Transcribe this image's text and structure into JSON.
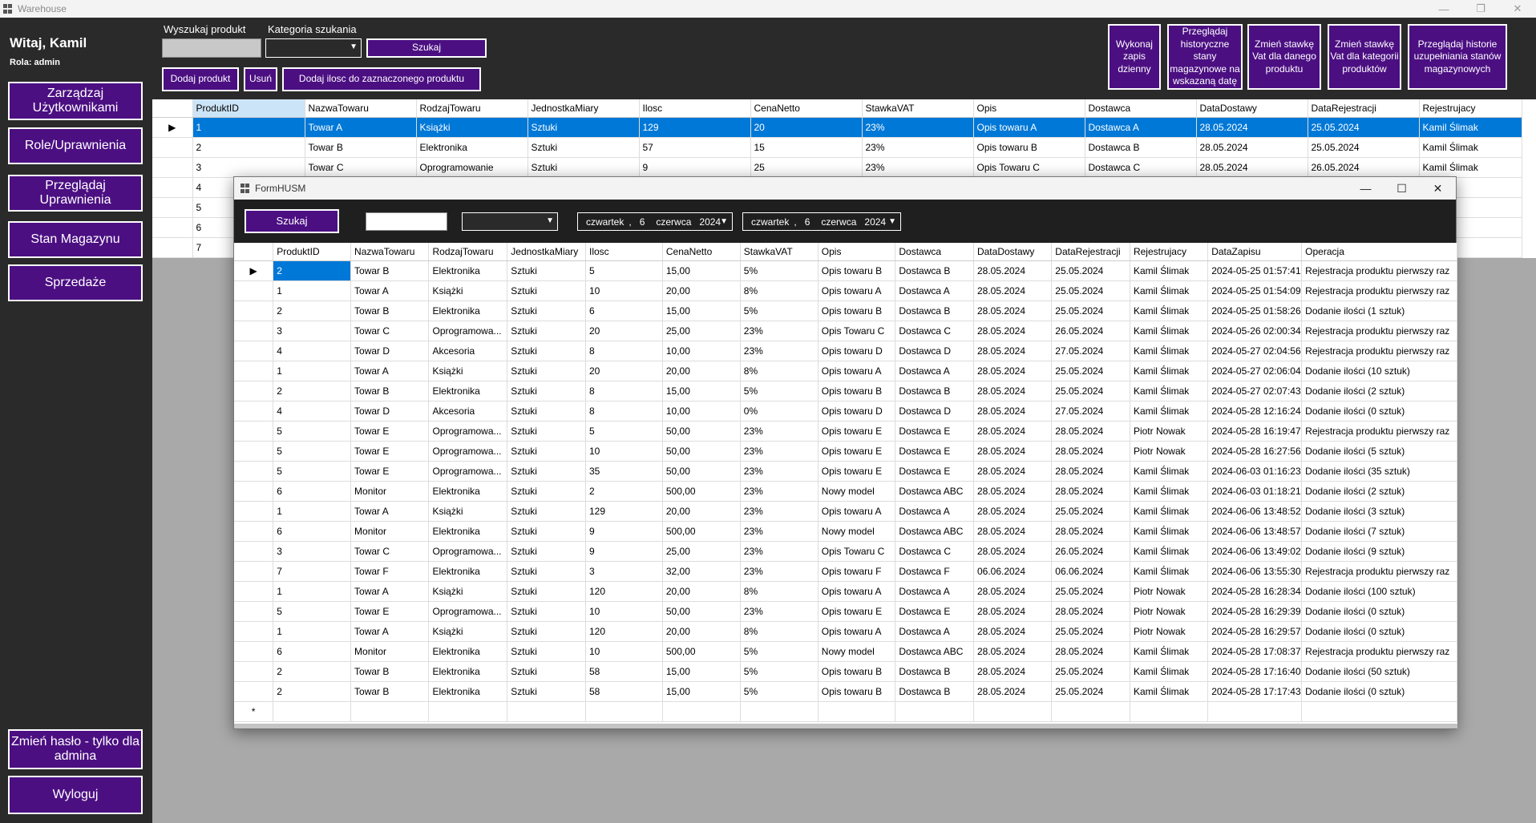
{
  "app": {
    "title": "Warehouse"
  },
  "window_controls": {
    "min": "—",
    "max": "❐",
    "close": "✕"
  },
  "sidebar": {
    "greeting": "Witaj, Kamil",
    "role": "Rola: admin",
    "buttons": {
      "manage_users": "Zarządzaj Użytkownikami",
      "roles": "Role/Uprawnienia",
      "view_permissions": "Przeglądaj Uprawnienia",
      "stock": "Stan Magazynu",
      "sales": "Sprzedaże",
      "change_password": "Zmień hasło - tylko dla admina",
      "logout": "Wyloguj"
    }
  },
  "toolbar": {
    "search_label": "Wyszukaj produkt",
    "category_label": "Kategoria szukania",
    "search_button": "Szukaj",
    "add_product": "Dodaj produkt",
    "delete": "Usuń",
    "add_quantity": "Dodaj ilosc do zaznaczonego produktu",
    "daily_save": "Wykonaj zapis dzienny",
    "history_states": "Przeglądaj historyczne stany magazynowe na wskazaną datę",
    "vat_product": "Zmień stawkę Vat dla danego produktu",
    "vat_category": "Zmień stawkę Vat dla kategorii produktów",
    "history_refill": "Przeglądaj historie uzupełniania stanów magazynowych"
  },
  "main_grid": {
    "columns": [
      "ProduktID",
      "NazwaTowaru",
      "RodzajTowaru",
      "JednostkaMiary",
      "Ilosc",
      "CenaNetto",
      "StawkaVAT",
      "Opis",
      "Dostawca",
      "DataDostawy",
      "DataRejestracji",
      "Rejestrujacy"
    ],
    "rows": [
      [
        "1",
        "Towar A",
        "Książki",
        "Sztuki",
        "129",
        "20",
        "23%",
        "Opis towaru A",
        "Dostawca A",
        "28.05.2024",
        "25.05.2024",
        "Kamil Ślimak"
      ],
      [
        "2",
        "Towar B",
        "Elektronika",
        "Sztuki",
        "57",
        "15",
        "23%",
        "Opis towaru B",
        "Dostawca B",
        "28.05.2024",
        "25.05.2024",
        "Kamil Ślimak"
      ],
      [
        "3",
        "Towar C",
        "Oprogramowanie",
        "Sztuki",
        "9",
        "25",
        "23%",
        "Opis Towaru C",
        "Dostawca C",
        "28.05.2024",
        "26.05.2024",
        "Kamil Ślimak"
      ],
      [
        "4",
        "",
        "",
        "",
        "",
        "",
        "",
        "",
        "",
        "",
        "",
        "Ślimak"
      ],
      [
        "5",
        "",
        "",
        "",
        "",
        "",
        "",
        "",
        "",
        "",
        "",
        "owak"
      ],
      [
        "6",
        "",
        "",
        "",
        "",
        "",
        "",
        "",
        "",
        "",
        "",
        "Ślimak"
      ],
      [
        "7",
        "",
        "",
        "",
        "",
        "",
        "",
        "",
        "",
        "",
        "",
        "Ślimak"
      ]
    ]
  },
  "modal": {
    "title": "FormHUSM",
    "search_button": "Szukaj",
    "date_from": {
      "day_name": "czwartek",
      "sep": ",",
      "day": "6",
      "month": "czerwca",
      "year": "2024"
    },
    "date_to": {
      "day_name": "czwartek",
      "sep": ",",
      "day": "6",
      "month": "czerwca",
      "year": "2024"
    },
    "columns": [
      "ProduktID",
      "NazwaTowaru",
      "RodzajTowaru",
      "JednostkaMiary",
      "Ilosc",
      "CenaNetto",
      "StawkaVAT",
      "Opis",
      "Dostawca",
      "DataDostawy",
      "DataRejestracji",
      "Rejestrujacy",
      "DataZapisu",
      "Operacja"
    ],
    "rows": [
      [
        "2",
        "Towar B",
        "Elektronika",
        "Sztuki",
        "5",
        "15,00",
        "5%",
        "Opis towaru B",
        "Dostawca B",
        "28.05.2024",
        "25.05.2024",
        "Kamil Ślimak",
        "2024-05-25 01:57:41",
        "Rejestracja produktu pierwszy raz"
      ],
      [
        "1",
        "Towar A",
        "Książki",
        "Sztuki",
        "10",
        "20,00",
        "8%",
        "Opis towaru A",
        "Dostawca A",
        "28.05.2024",
        "25.05.2024",
        "Kamil Ślimak",
        "2024-05-25 01:54:09",
        "Rejestracja produktu pierwszy raz"
      ],
      [
        "2",
        "Towar B",
        "Elektronika",
        "Sztuki",
        "6",
        "15,00",
        "5%",
        "Opis towaru B",
        "Dostawca B",
        "28.05.2024",
        "25.05.2024",
        "Kamil Ślimak",
        "2024-05-25 01:58:26",
        "Dodanie ilości (1 sztuk)"
      ],
      [
        "3",
        "Towar C",
        "Oprogramowa...",
        "Sztuki",
        "20",
        "25,00",
        "23%",
        "Opis Towaru C",
        "Dostawca C",
        "28.05.2024",
        "26.05.2024",
        "Kamil Ślimak",
        "2024-05-26 02:00:34",
        "Rejestracja produktu pierwszy raz"
      ],
      [
        "4",
        "Towar D",
        "Akcesoria",
        "Sztuki",
        "8",
        "10,00",
        "23%",
        "Opis towaru D",
        "Dostawca D",
        "28.05.2024",
        "27.05.2024",
        "Kamil Ślimak",
        "2024-05-27 02:04:56",
        "Rejestracja produktu pierwszy raz"
      ],
      [
        "1",
        "Towar A",
        "Książki",
        "Sztuki",
        "20",
        "20,00",
        "8%",
        "Opis towaru A",
        "Dostawca A",
        "28.05.2024",
        "25.05.2024",
        "Kamil Ślimak",
        "2024-05-27 02:06:04",
        "Dodanie ilości (10 sztuk)"
      ],
      [
        "2",
        "Towar B",
        "Elektronika",
        "Sztuki",
        "8",
        "15,00",
        "5%",
        "Opis towaru B",
        "Dostawca B",
        "28.05.2024",
        "25.05.2024",
        "Kamil Ślimak",
        "2024-05-27 02:07:43",
        "Dodanie ilości (2 sztuk)"
      ],
      [
        "4",
        "Towar D",
        "Akcesoria",
        "Sztuki",
        "8",
        "10,00",
        "0%",
        "Opis towaru D",
        "Dostawca D",
        "28.05.2024",
        "27.05.2024",
        "Kamil Ślimak",
        "2024-05-28 12:16:24",
        "Dodanie ilości (0 sztuk)"
      ],
      [
        "5",
        "Towar E",
        "Oprogramowa...",
        "Sztuki",
        "5",
        "50,00",
        "23%",
        "Opis towaru E",
        "Dostawca E",
        "28.05.2024",
        "28.05.2024",
        "Piotr Nowak",
        "2024-05-28 16:19:47",
        "Rejestracja produktu pierwszy raz"
      ],
      [
        "5",
        "Towar E",
        "Oprogramowa...",
        "Sztuki",
        "10",
        "50,00",
        "23%",
        "Opis towaru E",
        "Dostawca E",
        "28.05.2024",
        "28.05.2024",
        "Piotr Nowak",
        "2024-05-28 16:27:56",
        "Dodanie ilości (5 sztuk)"
      ],
      [
        "5",
        "Towar E",
        "Oprogramowa...",
        "Sztuki",
        "35",
        "50,00",
        "23%",
        "Opis towaru E",
        "Dostawca E",
        "28.05.2024",
        "28.05.2024",
        "Kamil Ślimak",
        "2024-06-03 01:16:23",
        "Dodanie ilości (35 sztuk)"
      ],
      [
        "6",
        "Monitor",
        "Elektronika",
        "Sztuki",
        "2",
        "500,00",
        "23%",
        "Nowy model",
        "Dostawca ABC",
        "28.05.2024",
        "28.05.2024",
        "Kamil Ślimak",
        "2024-06-03 01:18:21",
        "Dodanie ilości (2 sztuk)"
      ],
      [
        "1",
        "Towar A",
        "Książki",
        "Sztuki",
        "129",
        "20,00",
        "23%",
        "Opis towaru A",
        "Dostawca A",
        "28.05.2024",
        "25.05.2024",
        "Kamil Ślimak",
        "2024-06-06 13:48:52",
        "Dodanie ilości (3 sztuk)"
      ],
      [
        "6",
        "Monitor",
        "Elektronika",
        "Sztuki",
        "9",
        "500,00",
        "23%",
        "Nowy model",
        "Dostawca ABC",
        "28.05.2024",
        "28.05.2024",
        "Kamil Ślimak",
        "2024-06-06 13:48:57",
        "Dodanie ilości (7 sztuk)"
      ],
      [
        "3",
        "Towar C",
        "Oprogramowa...",
        "Sztuki",
        "9",
        "25,00",
        "23%",
        "Opis Towaru C",
        "Dostawca C",
        "28.05.2024",
        "26.05.2024",
        "Kamil Ślimak",
        "2024-06-06 13:49:02",
        "Dodanie ilości (9 sztuk)"
      ],
      [
        "7",
        "Towar F",
        "Elektronika",
        "Sztuki",
        "3",
        "32,00",
        "23%",
        "Opis towaru F",
        "Dostawca F",
        "06.06.2024",
        "06.06.2024",
        "Kamil Ślimak",
        "2024-06-06 13:55:30",
        "Rejestracja produktu pierwszy raz"
      ],
      [
        "1",
        "Towar A",
        "Książki",
        "Sztuki",
        "120",
        "20,00",
        "8%",
        "Opis towaru A",
        "Dostawca A",
        "28.05.2024",
        "25.05.2024",
        "Piotr Nowak",
        "2024-05-28 16:28:34",
        "Dodanie ilości (100 sztuk)"
      ],
      [
        "5",
        "Towar E",
        "Oprogramowa...",
        "Sztuki",
        "10",
        "50,00",
        "23%",
        "Opis towaru E",
        "Dostawca E",
        "28.05.2024",
        "28.05.2024",
        "Piotr Nowak",
        "2024-05-28 16:29:39",
        "Dodanie ilości (0 sztuk)"
      ],
      [
        "1",
        "Towar A",
        "Książki",
        "Sztuki",
        "120",
        "20,00",
        "8%",
        "Opis towaru A",
        "Dostawca A",
        "28.05.2024",
        "25.05.2024",
        "Piotr Nowak",
        "2024-05-28 16:29:57",
        "Dodanie ilości (0 sztuk)"
      ],
      [
        "6",
        "Monitor",
        "Elektronika",
        "Sztuki",
        "10",
        "500,00",
        "5%",
        "Nowy model",
        "Dostawca ABC",
        "28.05.2024",
        "28.05.2024",
        "Kamil Ślimak",
        "2024-05-28 17:08:37",
        "Rejestracja produktu pierwszy raz"
      ],
      [
        "2",
        "Towar B",
        "Elektronika",
        "Sztuki",
        "58",
        "15,00",
        "5%",
        "Opis towaru B",
        "Dostawca B",
        "28.05.2024",
        "25.05.2024",
        "Kamil Ślimak",
        "2024-05-28 17:16:40",
        "Dodanie ilości (50 sztuk)"
      ],
      [
        "2",
        "Towar B",
        "Elektronika",
        "Sztuki",
        "58",
        "15,00",
        "5%",
        "Opis towaru B",
        "Dostawca B",
        "28.05.2024",
        "25.05.2024",
        "Kamil Ślimak",
        "2024-05-28 17:17:43",
        "Dodanie ilości (0 sztuk)"
      ]
    ],
    "new_row_marker": "*",
    "current_row_marker": "▶"
  },
  "colors": {
    "accent": "#4b0f82",
    "selection": "#0078d7",
    "dark_bg": "#2a2a2a"
  }
}
